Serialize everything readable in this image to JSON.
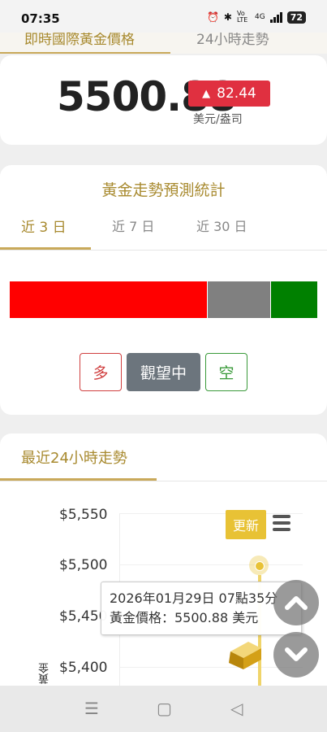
{
  "status": {
    "time": "07:35",
    "network": "4G",
    "lte": "Vo LTE",
    "battery": "72"
  },
  "top_tabs": {
    "active": "即時國際黃金價格",
    "inactive": "24小時走勢"
  },
  "price": {
    "value": "5500.88",
    "change": "82.44",
    "unit": "美元/盎司"
  },
  "stats": {
    "title": "黃金走勢預測統計",
    "periods": [
      "近 3 日",
      "近 7 日",
      "近 30 日"
    ],
    "distribution": [
      {
        "name": "多",
        "fraction": 0.645,
        "color": "#ff0000"
      },
      {
        "name": "觀望中",
        "fraction": 0.205,
        "color": "#808080"
      },
      {
        "name": "空",
        "fraction": 0.15,
        "color": "#008000"
      }
    ],
    "options": {
      "long": "多",
      "wait": "觀望中",
      "short": "空"
    }
  },
  "trend": {
    "title": "最近24小時走勢",
    "refresh": "更新",
    "y_axis_label": "黃金",
    "y_ticks": [
      "$5,550",
      "$5,500",
      "$5,450",
      "$5,400"
    ],
    "tooltip": {
      "date": "2026年01月29日 07點35分",
      "price_label": "黃金價格：5500.88 美元"
    }
  }
}
